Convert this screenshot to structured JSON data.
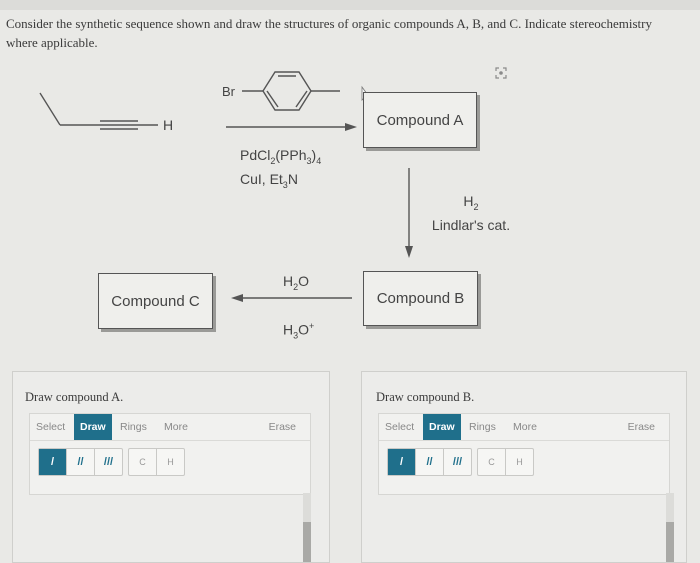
{
  "question": "Consider the synthetic sequence shown and draw the structures of organic compounds A, B, and C. Indicate stereochemistry where applicable.",
  "scheme": {
    "starting_material_label": "H",
    "aryl_halide_label": "Br",
    "reagents_step1": {
      "line1": "PdCl",
      "line1_sub1": "2",
      "line1_mid": "(PPh",
      "line1_sub2": "3",
      "line1_end": ")",
      "line1_sub3": "4",
      "line2": "CuI, Et",
      "line2_sub": "3",
      "line2_end": "N"
    },
    "reagents_step2": {
      "line1": "H",
      "line1_sub": "2",
      "line2": "Lindlar's cat."
    },
    "reagents_step3": {
      "top": "H",
      "top_sub": "2",
      "top_end": "O",
      "bottom": "H",
      "bottom_sub": "3",
      "bottom_end": "O",
      "bottom_sup": "+"
    },
    "compounds": {
      "a": "Compound A",
      "b": "Compound B",
      "c": "Compound C"
    },
    "corner_icon": "focus-icon"
  },
  "panels": [
    {
      "title": "Draw compound A.",
      "tabs": [
        "Select",
        "Draw",
        "Rings",
        "More"
      ],
      "active_tab": "Draw",
      "erase_label": "Erase",
      "bonds": [
        "/",
        "//",
        "///"
      ],
      "atoms": [
        "C",
        "H"
      ]
    },
    {
      "title": "Draw compound B.",
      "tabs": [
        "Select",
        "Draw",
        "Rings",
        "More"
      ],
      "active_tab": "Draw",
      "erase_label": "Erase",
      "bonds": [
        "/",
        "//",
        "///"
      ],
      "atoms": [
        "C",
        "H"
      ]
    }
  ]
}
